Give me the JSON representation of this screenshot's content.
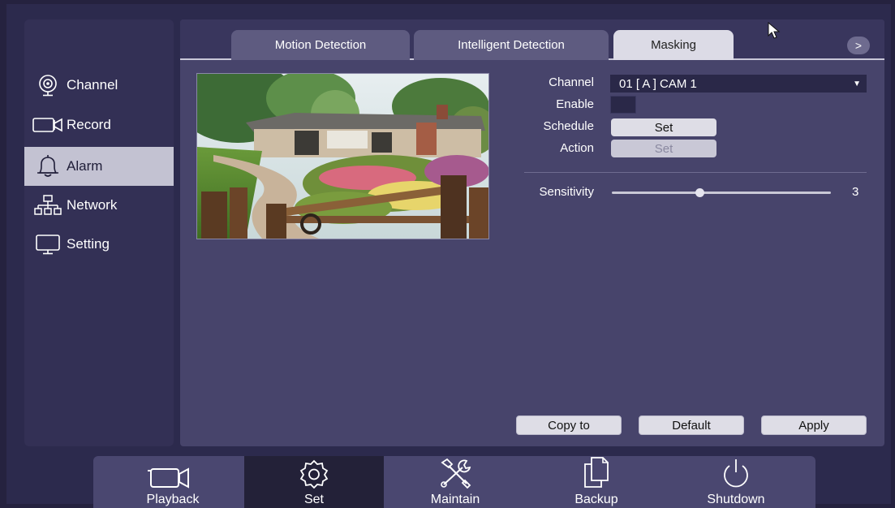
{
  "sidebar": {
    "items": [
      {
        "label": "Channel",
        "icon": "camera-icon",
        "active": false
      },
      {
        "label": "Record",
        "icon": "record-icon",
        "active": false
      },
      {
        "label": "Alarm",
        "icon": "bell-icon",
        "active": true
      },
      {
        "label": "Network",
        "icon": "network-icon",
        "active": false
      },
      {
        "label": "Setting",
        "icon": "monitor-icon",
        "active": false
      }
    ]
  },
  "tabs": [
    {
      "label": "Motion Detection",
      "active": false
    },
    {
      "label": "Intelligent Detection",
      "active": false
    },
    {
      "label": "Masking",
      "active": true
    }
  ],
  "tab_next_label": ">",
  "form": {
    "channel_label": "Channel",
    "channel_value": "01 [ A ] CAM 1",
    "enable_label": "Enable",
    "schedule_label": "Schedule",
    "schedule_button": "Set",
    "action_label": "Action",
    "action_button": "Set",
    "sensitivity_label": "Sensitivity",
    "sensitivity_value": "3",
    "sensitivity_fraction": 0.4
  },
  "actions": {
    "copy_to": "Copy to",
    "default": "Default",
    "apply": "Apply"
  },
  "dock": [
    {
      "label": "Playback",
      "icon": "video-camera-icon",
      "active": false
    },
    {
      "label": "Set",
      "icon": "gear-icon",
      "active": true
    },
    {
      "label": "Maintain",
      "icon": "tools-icon",
      "active": false
    },
    {
      "label": "Backup",
      "icon": "copy-icon",
      "active": false
    },
    {
      "label": "Shutdown",
      "icon": "power-icon",
      "active": false
    }
  ],
  "colors": {
    "background": "#2c2a4d",
    "panel": "#47446b",
    "sidebar_active": "#c3c2d2",
    "tab_active": "#dcdbe6"
  }
}
